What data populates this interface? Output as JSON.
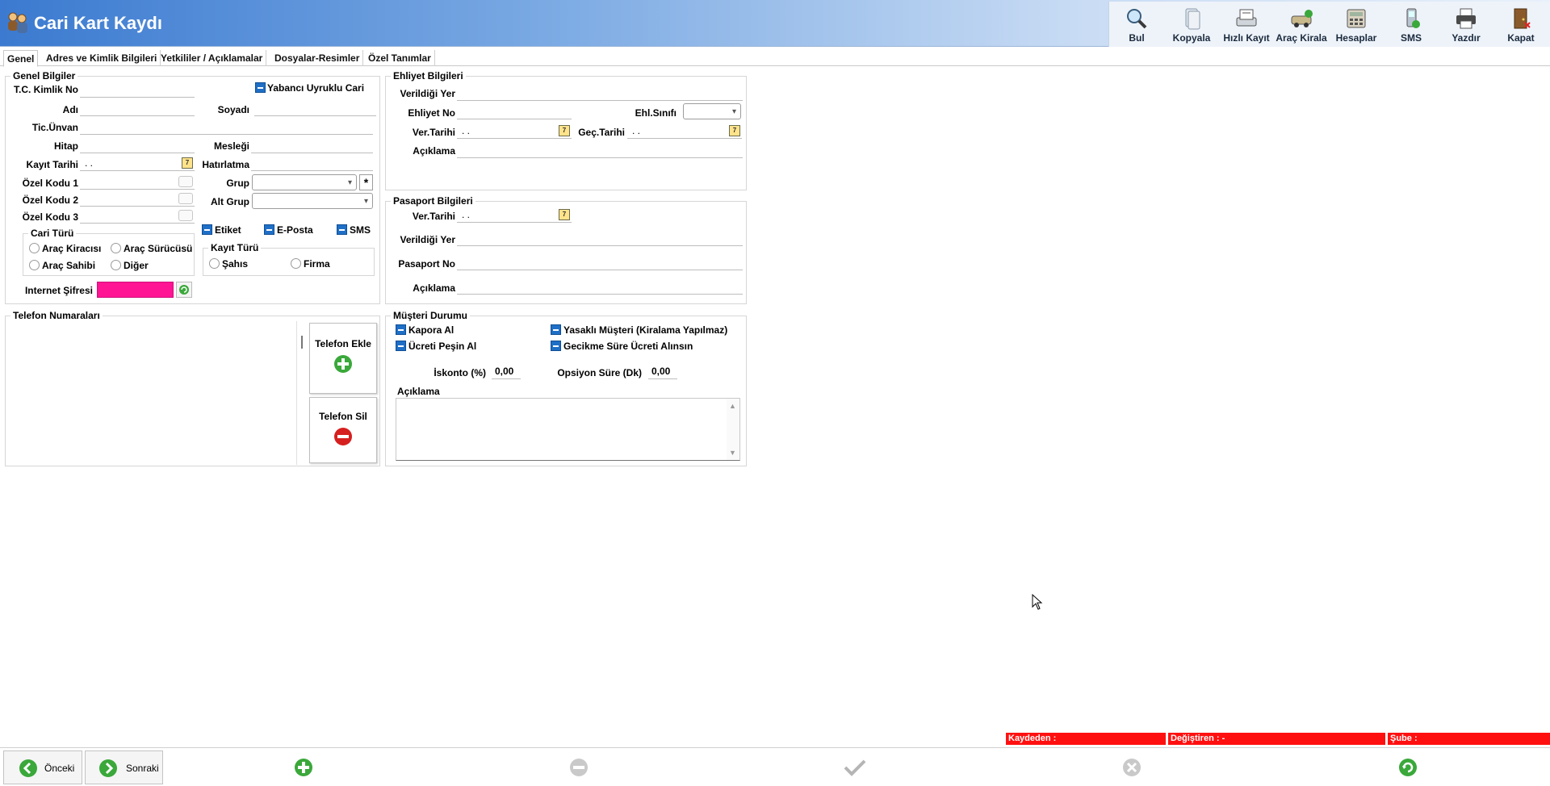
{
  "header": {
    "title": "Cari Kart Kaydı"
  },
  "toolbar": {
    "items": [
      {
        "label": "Bul",
        "icon": "magnifier-icon"
      },
      {
        "label": "Kopyala",
        "icon": "copy-icon"
      },
      {
        "label": "Hızlı Kayıt",
        "icon": "quick-save-icon"
      },
      {
        "label": "Araç Kirala",
        "icon": "car-rent-icon"
      },
      {
        "label": "Hesaplar",
        "icon": "calculator-icon"
      },
      {
        "label": "SMS",
        "icon": "phone-icon"
      },
      {
        "label": "Yazdır",
        "icon": "printer-icon"
      },
      {
        "label": "Kapat",
        "icon": "door-icon"
      }
    ]
  },
  "tabs": [
    "Genel",
    "Adres ve Kimlik Bilgileri",
    "Yetkililer / Açıklamalar",
    "Dosyalar-Resimler",
    "Özel Tanımlar"
  ],
  "genel": {
    "title": "Genel Bilgiler",
    "tc_label": "T.C. Kimlik No",
    "foreign_label": "Yabancı Uyruklu Cari",
    "adi_label": "Adı",
    "soyadi_label": "Soyadı",
    "unvan_label": "Tic.Ünvan",
    "hitap_label": "Hitap",
    "meslek_label": "Mesleği",
    "kayit_tarihi_label": "Kayıt Tarihi",
    "kayit_tarihi_value": " .  .",
    "hatirlatma_label": "Hatırlatma",
    "ozel1_label": "Özel Kodu 1",
    "ozel2_label": "Özel Kodu 2",
    "ozel3_label": "Özel Kodu 3",
    "grup_label": "Grup",
    "grup_star": "*",
    "altgrup_label": "Alt Grup",
    "etiket_label": "Etiket",
    "eposta_label": "E-Posta",
    "sms_label": "SMS",
    "cari_turu_title": "Cari Türü",
    "cari_turu_options": [
      "Araç Kiracısı",
      "Araç Sürücüsü",
      "Araç Sahibi",
      "Diğer"
    ],
    "kayit_turu_title": "Kayıt Türü",
    "kayit_turu_options": [
      "Şahıs",
      "Firma"
    ],
    "internet_label": "Internet Şifresi",
    "internet_color": "#ff1493"
  },
  "ehliyet": {
    "title": "Ehliyet Bilgileri",
    "verildigi_label": "Verildiği Yer",
    "no_label": "Ehliyet No",
    "sinif_label": "Ehl.Sınıfı",
    "ver_tarihi_label": "Ver.Tarihi",
    "ver_tarihi_value": " .  .",
    "gec_tarihi_label": "Geç.Tarihi",
    "gec_tarihi_value": " .  .",
    "aciklama_label": "Açıklama"
  },
  "pasaport": {
    "title": "Pasaport Bilgileri",
    "ver_tarihi_label": "Ver.Tarihi",
    "ver_tarihi_value": " .  .",
    "verildigi_label": "Verildiği Yer",
    "no_label": "Pasaport No",
    "aciklama_label": "Açıklama"
  },
  "telefon": {
    "title": "Telefon Numaraları",
    "add_label": "Telefon Ekle",
    "delete_label": "Telefon Sil"
  },
  "musteri": {
    "title": "Müşteri Durumu",
    "kapora_label": "Kapora Al",
    "yasakli_label": "Yasaklı Müşteri (Kiralama Yapılmaz)",
    "pesin_label": "Ücreti Peşin Al",
    "gecikme_label": "Gecikme Süre Ücreti Alınsın",
    "iskonto_label": "İskonto (%)",
    "iskonto_value": "0,00",
    "opsiyon_label": "Opsiyon Süre (Dk)",
    "opsiyon_value": "0,00",
    "aciklama_label": "Açıklama"
  },
  "status": {
    "kaydeden": "Kaydeden :",
    "degistiren": "Değiştiren :  -",
    "sube": "Şube :"
  },
  "bottom": {
    "prev_label": "Önceki",
    "next_label": "Sonraki"
  }
}
